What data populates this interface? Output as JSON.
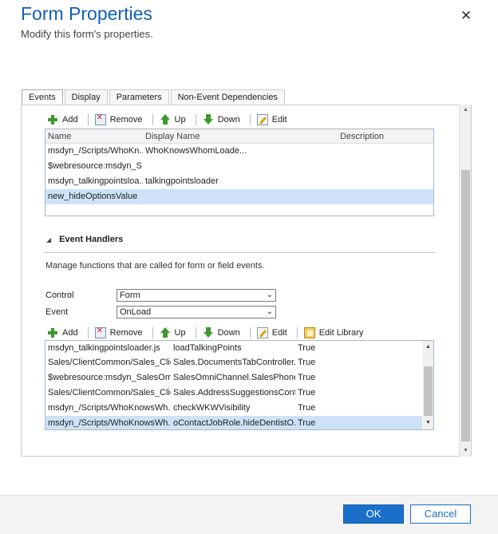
{
  "dialog": {
    "title": "Form Properties",
    "subtitle": "Modify this form's properties.",
    "close_glyph": "✕"
  },
  "tabs": [
    {
      "label": "Events",
      "active": true
    },
    {
      "label": "Display",
      "active": false
    },
    {
      "label": "Parameters",
      "active": false
    },
    {
      "label": "Non-Event Dependencies",
      "active": false
    }
  ],
  "libraries": {
    "toolbar": {
      "add": "Add",
      "remove": "Remove",
      "up": "Up",
      "down": "Down",
      "edit": "Edit"
    },
    "columns": {
      "name": "Name",
      "display_name": "Display Name",
      "description": "Description"
    },
    "rows": [
      {
        "name": "msdyn_/Scripts/WhoKn...",
        "display_name": "WhoKnowsWhomLoade...",
        "description": ""
      },
      {
        "name": "$webresource:msdyn_S...",
        "display_name": "",
        "description": ""
      },
      {
        "name": "msdyn_talkingpointsloa...",
        "display_name": "talkingpointsloader",
        "description": ""
      },
      {
        "name": "new_hideOptionsValue",
        "display_name": "",
        "description": "",
        "selected": true
      }
    ]
  },
  "event_handlers": {
    "heading": "Event Handlers",
    "collapse_glyph": "◢",
    "description": "Manage functions that are called for form or field events.",
    "control_label": "Control",
    "control_value": "Form",
    "event_label": "Event",
    "event_value": "OnLoad",
    "toolbar": {
      "add": "Add",
      "remove": "Remove",
      "up": "Up",
      "down": "Down",
      "edit": "Edit",
      "edit_library": "Edit Library"
    },
    "rows": [
      {
        "library": "msdyn_talkingpointsloader.js",
        "function": "loadTalkingPoints",
        "enabled": "True"
      },
      {
        "library": "Sales/ClientCommon/Sales_Clie...",
        "function": "Sales.DocumentsTabController....",
        "enabled": "True"
      },
      {
        "library": "$webresource:msdyn_SalesOm...",
        "function": "SalesOmniChannel.SalesPhone...",
        "enabled": "True"
      },
      {
        "library": "Sales/ClientCommon/Sales_Clie...",
        "function": "Sales.AddressSuggestionsContr...",
        "enabled": "True"
      },
      {
        "library": "msdyn_/Scripts/WhoKnowsWh...",
        "function": "checkWKWVisibility",
        "enabled": "True"
      },
      {
        "library": "msdyn_/Scripts/WhoKnowsWh...",
        "function": "oContactJobRole.hideDentistO...",
        "enabled": "True",
        "selected": true
      }
    ]
  },
  "footer": {
    "ok": "OK",
    "cancel": "Cancel"
  },
  "colors": {
    "accent": "#1a6fc9",
    "title": "#1160b7",
    "selection": "#cde2f7",
    "add_icon": "#3a9a2b",
    "remove_icon": "#d02020"
  }
}
